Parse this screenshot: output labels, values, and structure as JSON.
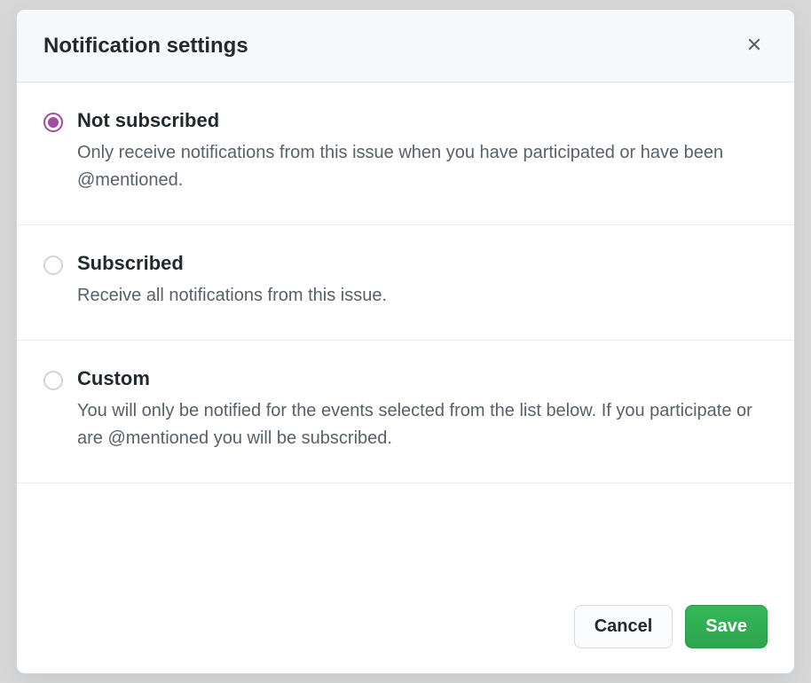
{
  "modal": {
    "title": "Notification settings",
    "selected": "not-subscribed",
    "options": [
      {
        "id": "not-subscribed",
        "title": "Not subscribed",
        "description": "Only receive notifications from this issue when you have participated or have been @mentioned."
      },
      {
        "id": "subscribed",
        "title": "Subscribed",
        "description": "Receive all notifications from this issue."
      },
      {
        "id": "custom",
        "title": "Custom",
        "description": "You will only be notified for the events selected from the list below. If you participate or are @mentioned you will be subscribed."
      }
    ],
    "buttons": {
      "cancel": "Cancel",
      "save": "Save"
    }
  }
}
